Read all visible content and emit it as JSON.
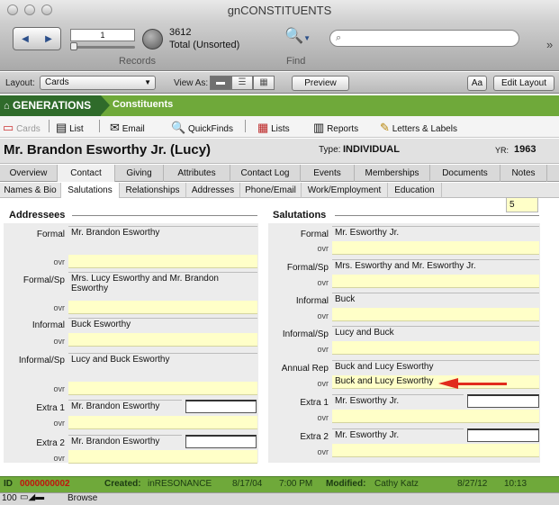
{
  "window": {
    "title": "gnCONSTITUENTS"
  },
  "toolbar": {
    "record_number": "1",
    "record_count": "3612",
    "sort_status": "Total (Unsorted)",
    "records_label": "Records",
    "find_label": "Find"
  },
  "layoutbar": {
    "layout_label": "Layout:",
    "layout_value": "Cards",
    "view_as_label": "View As:",
    "preview_label": "Preview",
    "font_button": "Aa",
    "edit_layout_label": "Edit Layout"
  },
  "banner": {
    "app": "GENERATIONS",
    "module": "Constituents"
  },
  "nav": [
    {
      "label": "Cards",
      "icon": "cards-icon"
    },
    {
      "label": "List",
      "icon": "list-icon"
    },
    {
      "label": "Email",
      "icon": "email-icon"
    },
    {
      "label": "QuickFinds",
      "icon": "magnifier-icon"
    },
    {
      "label": "Lists",
      "icon": "lists-icon"
    },
    {
      "label": "Reports",
      "icon": "reports-icon"
    },
    {
      "label": "Letters & Labels",
      "icon": "letters-icon"
    }
  ],
  "record": {
    "name": "Mr. Brandon Esworthy Jr. (Lucy)",
    "type_label": "Type:",
    "type_value": "INDIVIDUAL",
    "yr_label": "YR:",
    "yr_value": "1963"
  },
  "tabs": [
    "Overview",
    "Contact",
    "Giving",
    "Attributes",
    "Contact Log",
    "Events",
    "Memberships",
    "Documents",
    "Notes"
  ],
  "subtabs": [
    "Names & Bio",
    "Salutations",
    "Relationships",
    "Addresses",
    "Phone/Email",
    "Work/Employment",
    "Education"
  ],
  "counter": "5",
  "addressees": {
    "title": "Addressees",
    "ovr_label": "ovr",
    "fields": [
      {
        "label": "Formal",
        "value": "Mr. Brandon Esworthy"
      },
      {
        "label": "Formal/Sp",
        "value": "Mrs. Lucy Esworthy and Mr. Brandon Esworthy"
      },
      {
        "label": "Informal",
        "value": "Buck Esworthy"
      },
      {
        "label": "Informal/Sp",
        "value": "Lucy and Buck Esworthy"
      },
      {
        "label": "Extra 1",
        "value": "Mr. Brandon Esworthy"
      },
      {
        "label": "Extra 2",
        "value": "Mr. Brandon Esworthy"
      }
    ]
  },
  "salutations": {
    "title": "Salutations",
    "ovr_label": "ovr",
    "fields": [
      {
        "label": "Formal",
        "value": "Mr. Esworthy Jr.",
        "ovr": ""
      },
      {
        "label": "Formal/Sp",
        "value": "Mrs. Esworthy and Mr. Esworthy Jr.",
        "ovr": ""
      },
      {
        "label": "Informal",
        "value": "Buck",
        "ovr": ""
      },
      {
        "label": "Informal/Sp",
        "value": "Lucy and Buck",
        "ovr": ""
      },
      {
        "label": "Annual Rep",
        "value": "Buck and Lucy Esworthy",
        "ovr": "Buck and Lucy Esworthy"
      },
      {
        "label": "Extra 1",
        "value": "Mr. Esworthy Jr.",
        "ovr": ""
      },
      {
        "label": "Extra 2",
        "value": "Mr. Esworthy Jr.",
        "ovr": ""
      }
    ]
  },
  "footer": {
    "id_label": "ID",
    "id_value": "0000000002",
    "created_label": "Created:",
    "created_by": "inRESONANCE",
    "created_date": "8/17/04",
    "created_time": "7:00 PM",
    "modified_label": "Modified:",
    "modified_by": "Cathy Katz",
    "modified_date": "8/27/12",
    "modified_time": "10:13"
  },
  "statusbar": {
    "zoom": "100",
    "mode": "Browse"
  },
  "colors": {
    "banner_green": "#6fa93a",
    "dark_green": "#2f6b2a",
    "ovr_yellow": "#ffffc8",
    "arrow_red": "#e12b1d",
    "id_red": "#c0140e"
  }
}
